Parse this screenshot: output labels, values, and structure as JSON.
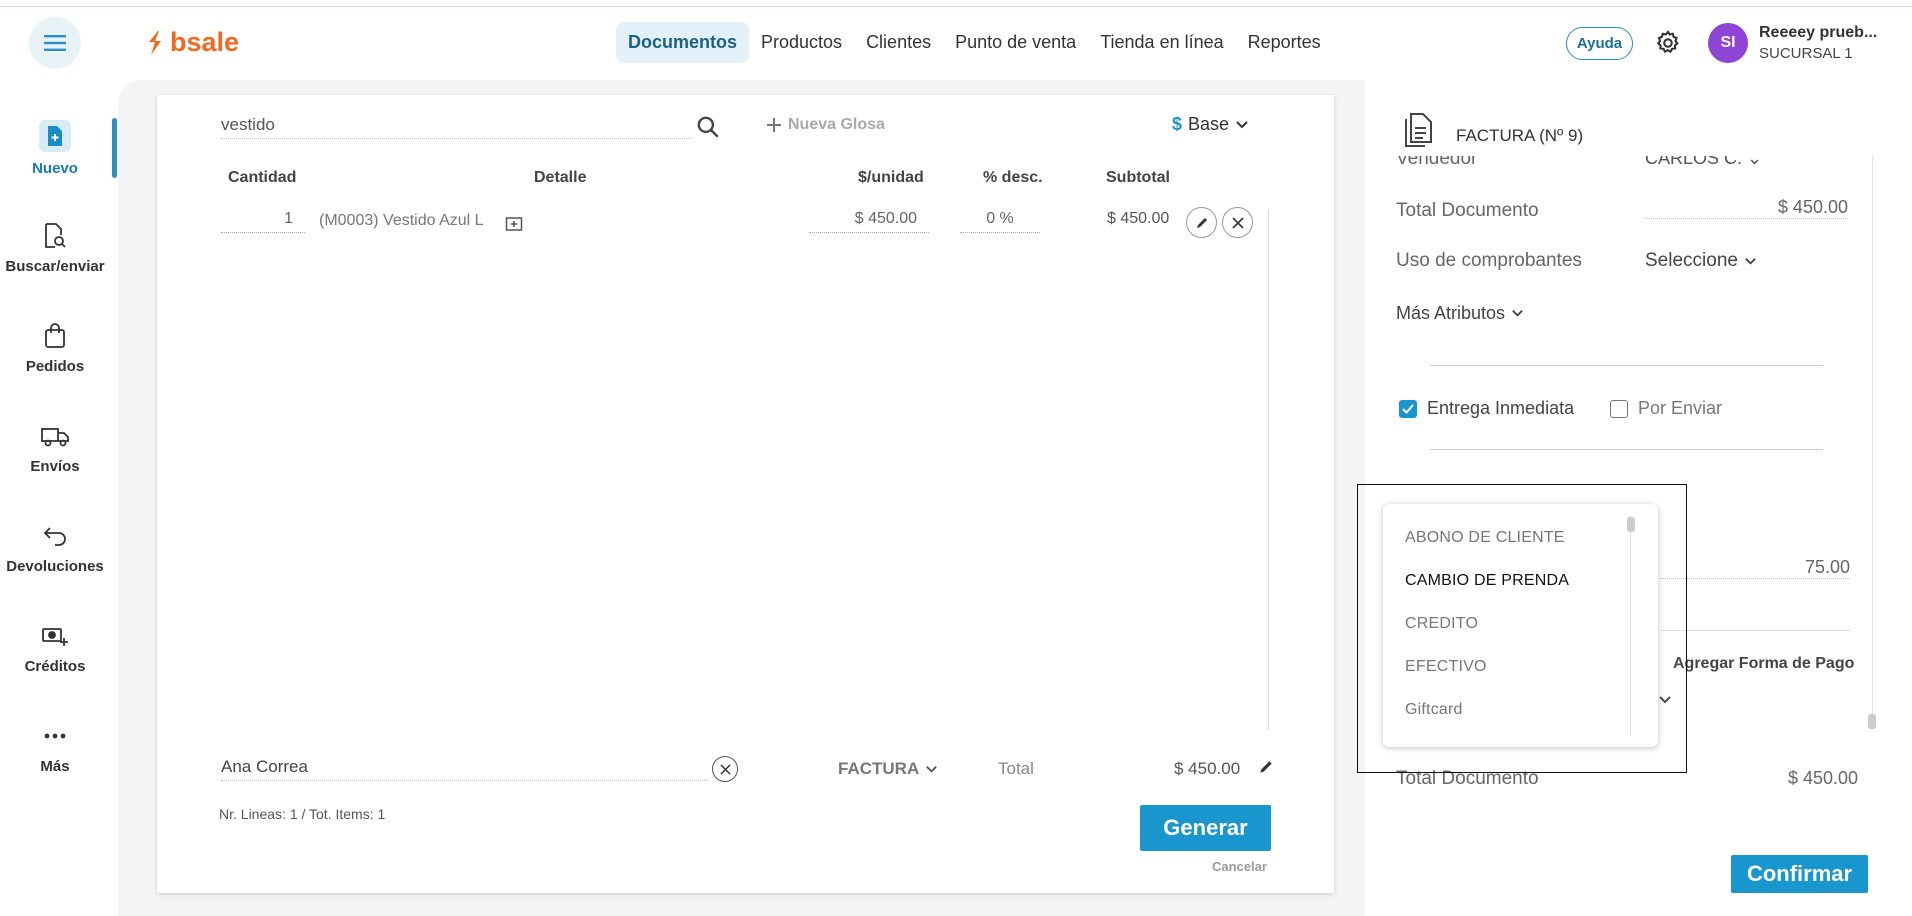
{
  "brand": {
    "name": "bsale",
    "color": "#f26a21"
  },
  "colors": {
    "accent": "#1a96cf",
    "avatar": "#8e44d4"
  },
  "nav": {
    "items": [
      {
        "label": "Documentos",
        "active": true
      },
      {
        "label": "Productos"
      },
      {
        "label": "Clientes"
      },
      {
        "label": "Punto de venta"
      },
      {
        "label": "Tienda en línea"
      },
      {
        "label": "Reportes"
      }
    ]
  },
  "header": {
    "help_label": "Ayuda",
    "avatar_initials": "SI",
    "user_name": "Reeeey prueb...",
    "branch": "SUCURSAL 1"
  },
  "sidebar": {
    "items": [
      {
        "label": "Nuevo",
        "icon": "new-document-icon",
        "active": true
      },
      {
        "label": "Buscar/enviar",
        "icon": "search-document-icon"
      },
      {
        "label": "Pedidos",
        "icon": "shopping-bag-icon"
      },
      {
        "label": "Envíos",
        "icon": "truck-icon"
      },
      {
        "label": "Devoluciones",
        "icon": "return-arrow-icon"
      },
      {
        "label": "Créditos",
        "icon": "cash-plus-icon"
      },
      {
        "label": "Más",
        "icon": "more-dots-icon"
      }
    ]
  },
  "document": {
    "search_value": "vestido",
    "nueva_glosa": "Nueva Glosa",
    "base_label": "Base",
    "headers": {
      "cantidad": "Cantidad",
      "detalle": "Detalle",
      "unit": "$/unidad",
      "desc": "% desc.",
      "subtotal": "Subtotal"
    },
    "rows": [
      {
        "qty": "1",
        "detail": "(M0003) Vestido Azul L",
        "unit_price": "$ 450.00",
        "discount": "0 %",
        "subtotal": "$ 450.00"
      }
    ],
    "client": "Ana Correa",
    "doc_type": "FACTURA",
    "total_label": "Total",
    "total_value": "$ 450.00",
    "line_summary": "Nr. Lineas: 1 / Tot. Items: 1",
    "generate_label": "Generar",
    "cancel_label": "Cancelar"
  },
  "right_panel": {
    "doc_title": "FACTURA (Nº 9)",
    "vendedor_label": "Vendedor",
    "vendedor_value": "CARLOS C.",
    "total_doc_label": "Total Documento",
    "total_doc_value": "$ 450.00",
    "uso_label": "Uso de comprobantes",
    "uso_value": "Seleccione",
    "mas_atributos": "Más Atributos",
    "entrega_inmediata": "Entrega Inmediata",
    "por_enviar": "Por Enviar",
    "partial_amount": "75.00",
    "agregar_pago": "Agregar Forma de Pago",
    "total_doc_bottom_label": "Total Documento",
    "total_doc_bottom_value": "$ 450.00",
    "confirm_label": "Confirmar"
  },
  "payment_dropdown": {
    "options": [
      "ABONO DE CLIENTE",
      "CAMBIO DE PRENDA",
      "CREDITO",
      "EFECTIVO",
      "Giftcard"
    ],
    "highlighted": "CAMBIO DE PRENDA"
  }
}
